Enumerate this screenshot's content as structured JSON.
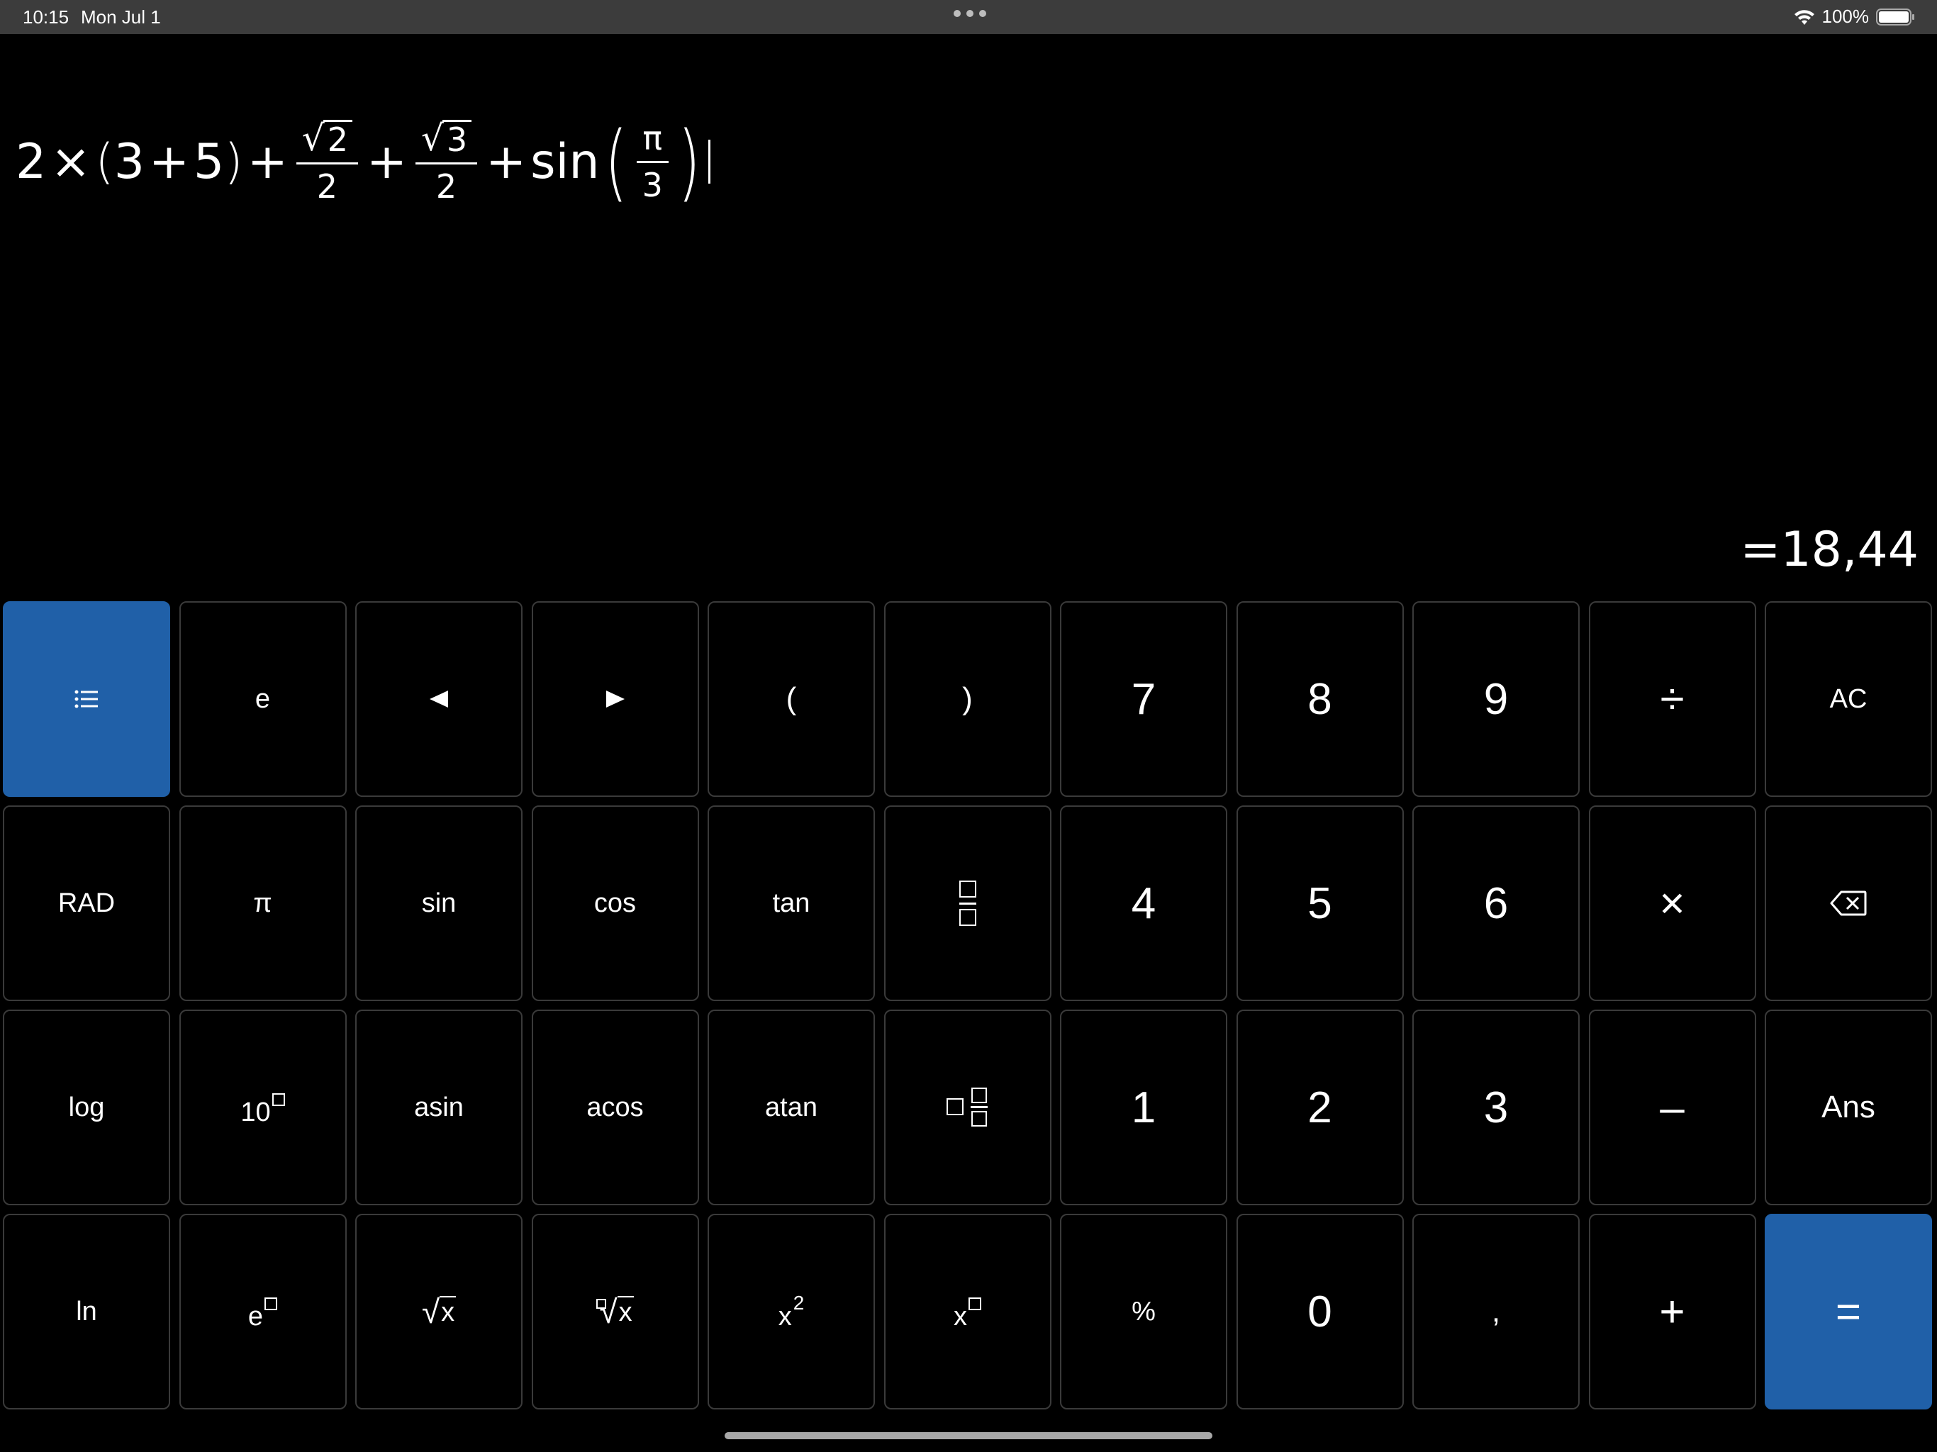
{
  "status_bar": {
    "time": "10:15",
    "date": "Mon Jul 1",
    "battery": "100%"
  },
  "expression": {
    "t1": "2",
    "times": "×",
    "lparen": "(",
    "t3": "3",
    "plus1": "+",
    "t5": "5",
    "rparen": ")",
    "plus2": "+",
    "frac1_rad": "2",
    "frac1_den": "2",
    "plus3": "+",
    "frac2_rad": "3",
    "frac2_den": "2",
    "plus4": "+",
    "fn": "sin",
    "frac3_num": "π",
    "frac3_den": "3"
  },
  "result": "=18,44",
  "keys": {
    "row1": [
      "e",
      "(",
      ")",
      "7",
      "8",
      "9",
      "÷",
      "AC"
    ],
    "row2": [
      "RAD",
      "π",
      "sin",
      "cos",
      "tan",
      "4",
      "5",
      "6",
      "×"
    ],
    "row3": [
      "log",
      "10",
      "asin",
      "acos",
      "atan",
      "1",
      "2",
      "3",
      "–",
      "Ans"
    ],
    "row4": [
      "ln",
      "e",
      "x",
      "x",
      "x",
      "2",
      "x",
      "%",
      "0",
      ",",
      "+",
      "="
    ]
  },
  "colors": {
    "accent": "#2060a8",
    "status_bar": "#3c3c3c",
    "key_border": "#3a3a3a"
  }
}
